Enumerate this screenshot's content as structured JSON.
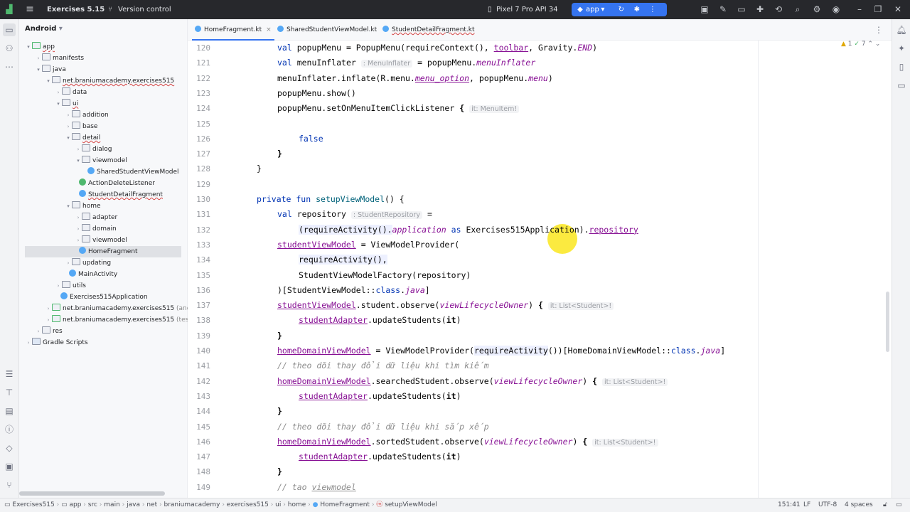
{
  "topbar": {
    "project_name": "Exercises 5.15",
    "vcs_label": "Version control",
    "device": "Pixel 7 Pro API 34",
    "run_config": "app"
  },
  "project_panel": {
    "title": "Android",
    "tree": [
      {
        "label": "app",
        "suffix": ""
      },
      {
        "label": "manifests",
        "suffix": ""
      },
      {
        "label": "java",
        "suffix": ""
      },
      {
        "label": "net.braniumacademy.exercises515",
        "suffix": ""
      },
      {
        "label": "data",
        "suffix": ""
      },
      {
        "label": "ui",
        "suffix": ""
      },
      {
        "label": "addition",
        "suffix": ""
      },
      {
        "label": "base",
        "suffix": ""
      },
      {
        "label": "detail",
        "suffix": ""
      },
      {
        "label": "dialog",
        "suffix": ""
      },
      {
        "label": "viewmodel",
        "suffix": ""
      },
      {
        "label": "SharedStudentViewModel",
        "suffix": ""
      },
      {
        "label": "ActionDeleteListener",
        "suffix": ""
      },
      {
        "label": "StudentDetailFragment",
        "suffix": ""
      },
      {
        "label": "home",
        "suffix": ""
      },
      {
        "label": "adapter",
        "suffix": ""
      },
      {
        "label": "domain",
        "suffix": ""
      },
      {
        "label": "viewmodel",
        "suffix": ""
      },
      {
        "label": "HomeFragment",
        "suffix": ""
      },
      {
        "label": "updating",
        "suffix": ""
      },
      {
        "label": "MainActivity",
        "suffix": ""
      },
      {
        "label": "utils",
        "suffix": ""
      },
      {
        "label": "Exercises515Application",
        "suffix": ""
      },
      {
        "label": "net.braniumacademy.exercises515",
        "suffix": "(androi"
      },
      {
        "label": "net.braniumacademy.exercises515",
        "suffix": "(test)"
      },
      {
        "label": "res",
        "suffix": ""
      },
      {
        "label": "Gradle Scripts",
        "suffix": ""
      }
    ]
  },
  "tabs": [
    {
      "label": "HomeFragment.kt"
    },
    {
      "label": "SharedStudentViewModel.kt"
    },
    {
      "label": "StudentDetailFragment.kt"
    }
  ],
  "inspection": {
    "warnings": "1",
    "checks": "7"
  },
  "editor": {
    "line_numbers": [
      "120",
      "121",
      "122",
      "123",
      "124",
      "125",
      "126",
      "127",
      "128",
      "129",
      "130",
      "131",
      "132",
      "133",
      "134",
      "135",
      "136",
      "137",
      "138",
      "139",
      "140",
      "141",
      "142",
      "143",
      "144",
      "145",
      "146",
      "147",
      "148",
      "149"
    ],
    "code": {
      "l120_a": "val ",
      "l120_b": "popupMenu = PopupMenu(requireContext(), ",
      "l120_c": "toolbar",
      "l120_d": ", Gravity.",
      "l120_e": "END",
      "l120_f": ")",
      "l121_a": "val ",
      "l121_b": "menuInflater",
      "l121_hint": ": MenuInflater",
      "l121_c": " = popupMenu.",
      "l121_d": "menuInflater",
      "l122_a": "menuInflater.inflate(R.menu.",
      "l122_b": "menu_option",
      "l122_c": ", popupMenu.",
      "l122_d": "menu",
      "l122_e": ")",
      "l123": "popupMenu.show()",
      "l124_a": "popupMenu.setOnMenuItemClickListener ",
      "l124_b": "{",
      "l124_hint": "it: MenuItem!",
      "l126": "false",
      "l127": "}",
      "l128": "}",
      "l130_a": "private fun ",
      "l130_b": "setupViewModel",
      "l130_c": "() {",
      "l131_a": "val ",
      "l131_b": "repository",
      "l131_hint": ": StudentRepository",
      "l131_c": " =",
      "l132_a": "(requireActivity().",
      "l132_b": "application",
      "l132_c": " as ",
      "l132_d": "Exercises515Application).",
      "l132_e": "repository",
      "l133_a": "studentViewModel",
      "l133_b": " = ViewModelProvider(",
      "l134": "requireActivity(),",
      "l135": "StudentViewModelFactory(repository)",
      "l136_a": ")[StudentViewModel::",
      "l136_b": "class",
      "l136_c": ".",
      "l136_d": "java",
      "l136_e": "]",
      "l137_a": "studentViewModel",
      "l137_b": ".student.observe(",
      "l137_c": "viewLifecycleOwner",
      "l137_d": ") ",
      "l137_e": "{",
      "l137_hint": "it: List<Student>!",
      "l138_a": "studentAdapter",
      "l138_b": ".updateStudents(",
      "l138_c": "it",
      "l138_d": ")",
      "l139": "}",
      "l140_a": "homeDomainViewModel",
      "l140_b": " = ViewModelProvider(",
      "l140_c": "requireActivity",
      "l140_d": "())[HomeDomainViewModel::",
      "l140_e": "class",
      "l140_f": ".",
      "l140_g": "java",
      "l140_h": "]",
      "l141": "// theo dõi thay đổi dữ liệu khi tìm kiếm",
      "l142_a": "homeDomainViewModel",
      "l142_b": ".searchedStudent.observe(",
      "l142_c": "viewLifecycleOwner",
      "l142_d": ") ",
      "l142_e": "{",
      "l142_hint": "it: List<Student>!",
      "l143_a": "studentAdapter",
      "l143_b": ".updateStudents(",
      "l143_c": "it",
      "l143_d": ")",
      "l144": "}",
      "l145": "// theo dõi thay đổi dữ liệu khi sắp xếp",
      "l146_a": "homeDomainViewModel",
      "l146_b": ".sortedStudent.observe(",
      "l146_c": "viewLifecycleOwner",
      "l146_d": ") ",
      "l146_e": "{",
      "l146_hint": "it: List<Student>!",
      "l147_a": "studentAdapter",
      "l147_b": ".updateStudents(",
      "l147_c": "it",
      "l147_d": ")",
      "l148": "}",
      "l149_a": "// tao ",
      "l149_b": "viewmodel"
    }
  },
  "statusbar": {
    "breadcrumbs": [
      "Exercises515",
      "app",
      "src",
      "main",
      "java",
      "net",
      "braniumacademy",
      "exercises515",
      "ui",
      "home",
      "HomeFragment",
      "setupViewModel"
    ],
    "position": "151:41",
    "line_sep": "LF",
    "encoding": "UTF-8",
    "indent": "4 spaces"
  },
  "colors": {
    "accent": "#3574f0",
    "keyword": "#0033b3",
    "property": "#871094",
    "comment": "#8c8c8c",
    "cursor_highlight": "#fae61e"
  }
}
